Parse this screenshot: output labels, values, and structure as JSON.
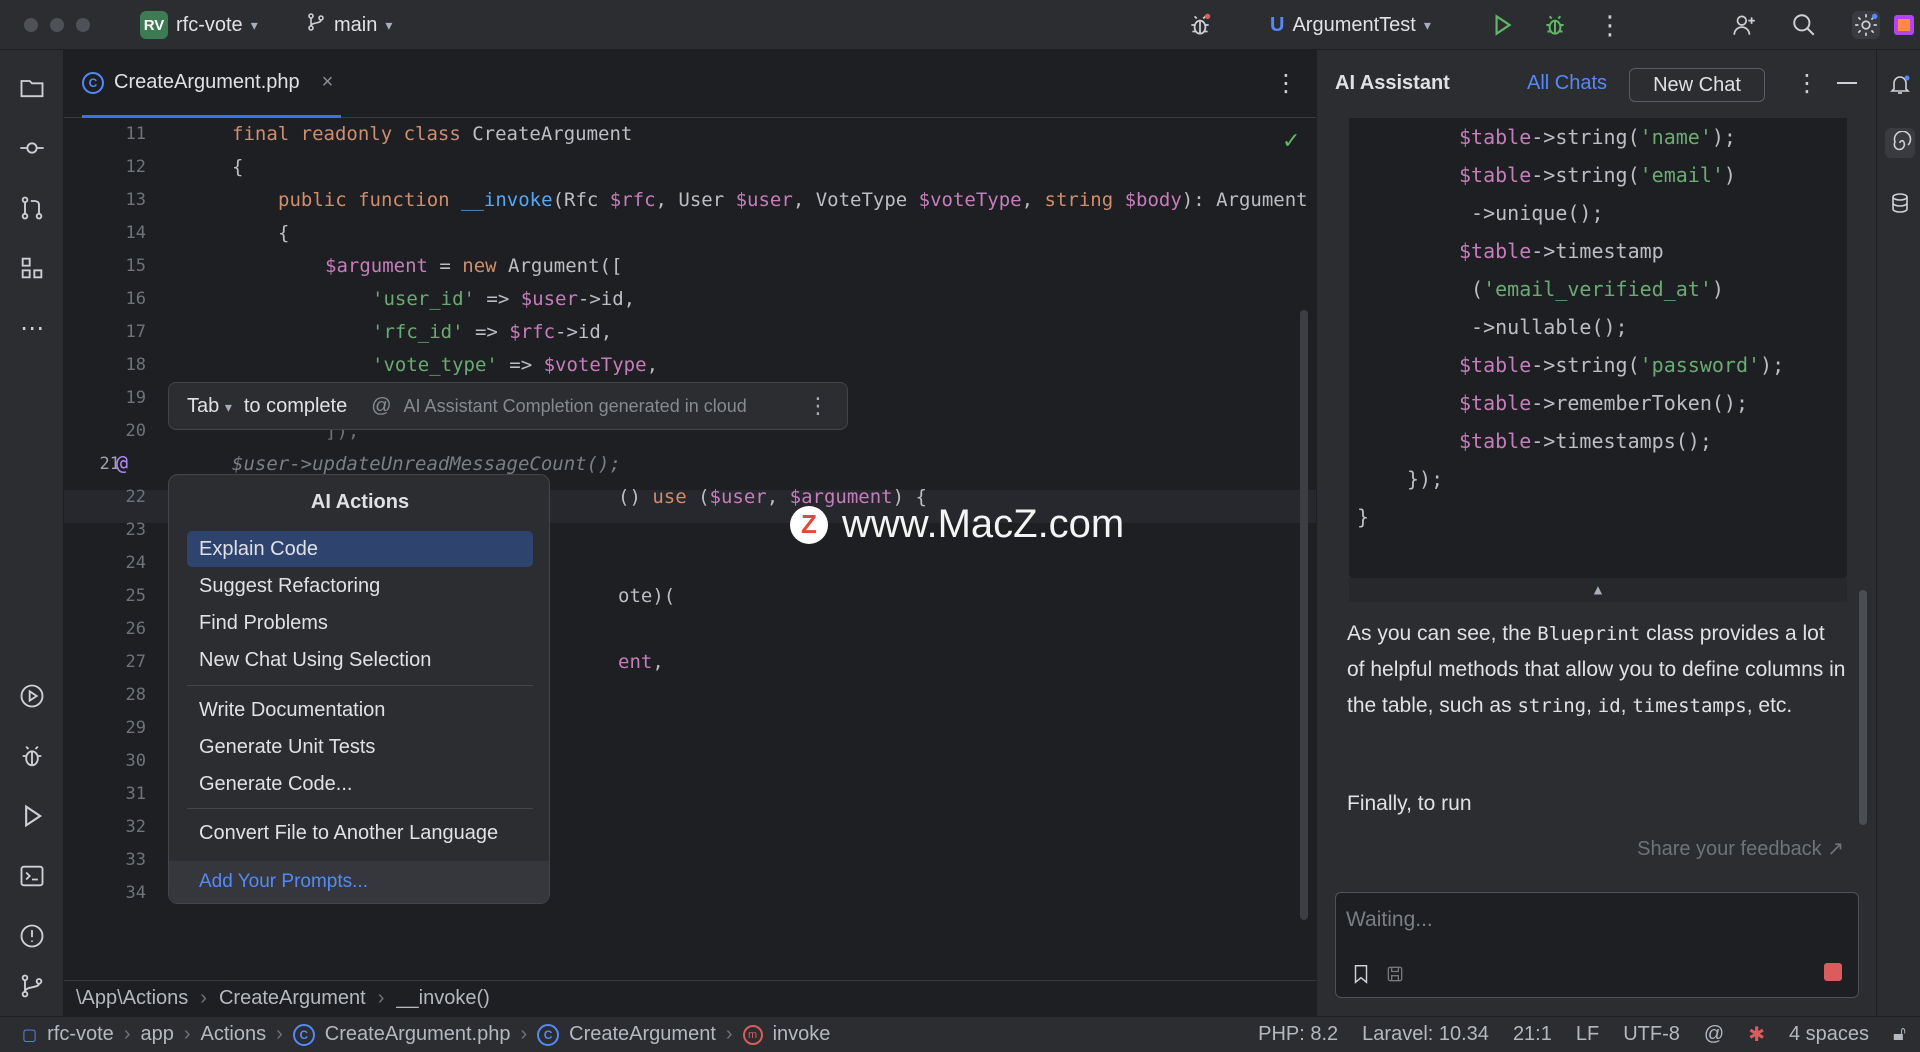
{
  "titlebar": {
    "project_badge": "RV",
    "project_name": "rfc-vote",
    "branch": "main",
    "run_config_badge": "U",
    "run_config": "ArgumentTest"
  },
  "editor": {
    "tab_label": "CreateArgument.php",
    "tab_icon_letter": "C",
    "line_numbers": [
      "11",
      "12",
      "13",
      "14",
      "15",
      "16",
      "17",
      "18",
      "19",
      "20",
      "21",
      "22",
      "23",
      "24",
      "25",
      "26",
      "27",
      "28",
      "29",
      "30",
      "31",
      "32",
      "33",
      "34"
    ],
    "code": {
      "l11_kw": "final readonly class",
      "l11_name": " CreateArgument",
      "l12": "{",
      "l13_kw": "public function",
      "l13_fn": "__invoke",
      "l13_p1": "(Rfc ",
      "l13_v1": "$rfc",
      "l13_p2": ", User ",
      "l13_v2": "$user",
      "l13_p3": ", VoteType ",
      "l13_v3": "$voteType",
      "l13_p4": ", ",
      "l13_kw2": "string",
      "l13_p5": " ",
      "l13_v4": "$body",
      "l13_p6": "): Argument",
      "l14": "{",
      "l15_v": "$argument",
      "l15_p1": " = ",
      "l15_kw": "new",
      "l15_p2": " Argument([",
      "l16_s": "'user_id'",
      "l16_p": " => ",
      "l16_v": "$user",
      "l16_e": "->id,",
      "l17_s": "'rfc_id'",
      "l17_p": " => ",
      "l17_v": "$rfc",
      "l17_e": "->id,",
      "l18_s": "'vote_type'",
      "l18_p": " => ",
      "l18_v": "$voteType",
      "l18_e": ",",
      "l20": "]);",
      "l21_ghost": "$user->updateUnreadMessageCount();",
      "l22_p": "() ",
      "l22_kw": "use",
      "l22_p2": " (",
      "l22_v1": "$user",
      "l22_p3": ", ",
      "l22_v2": "$argument",
      "l22_p4": ") {",
      "l25": "ote)(",
      "l27_var": "ent",
      "l27_end": ","
    },
    "breadcrumb": [
      "\\App\\Actions",
      "CreateArgument",
      "__invoke()"
    ]
  },
  "completion": {
    "key": "Tab",
    "action": "to complete",
    "note": "AI Assistant Completion generated in cloud"
  },
  "ai_actions": {
    "title": "AI Actions",
    "group1": [
      "Explain Code",
      "Suggest Refactoring",
      "Find Problems",
      "New Chat Using Selection"
    ],
    "group2": [
      "Write Documentation",
      "Generate Unit Tests",
      "Generate Code..."
    ],
    "group3": [
      "Convert File to Another Language"
    ],
    "footer": "Add Your Prompts..."
  },
  "watermark": {
    "logo_letter": "Z",
    "text": "www.MacZ.com"
  },
  "ai_panel": {
    "title": "AI Assistant",
    "all_chats": "All Chats",
    "new_chat": "New Chat",
    "code_lines": {
      "c1_v": "$table",
      "c1_m": "->string(",
      "c1_s": "'name'",
      "c1_e": ");",
      "c2_v": "$table",
      "c2_m": "->string(",
      "c2_s": "'email'",
      "c2_e": ")",
      "c3": " ->unique();",
      "c4_v": "$table",
      "c4_m": "->timestamp",
      "c5_p": " (",
      "c5_s": "'email_verified_at'",
      "c5_e": ")",
      "c6": " ->nullable();",
      "c7_v": "$table",
      "c7_m": "->string(",
      "c7_s": "'password'",
      "c7_e": ");",
      "c8_v": "$table",
      "c8_m": "->rememberToken();",
      "c9_v": "$table",
      "c9_m": "->timestamps();",
      "c10": "});",
      "c11": "}"
    },
    "para1_a": "As you can see, the ",
    "para1_code1": "Blueprint",
    "para1_b": " class provides a lot of helpful methods that allow you to define columns in the table, such as ",
    "para1_code2": "string",
    "para1_c": ", ",
    "para1_code3": "id",
    "para1_d": ", ",
    "para1_code4": "timestamps",
    "para1_e": ", etc.",
    "para2": "Finally, to run",
    "feedback": "Share your feedback ↗",
    "input_placeholder": "Waiting..."
  },
  "statusbar": {
    "left": [
      "rfc-vote",
      "app",
      "Actions",
      "CreateArgument.php",
      "CreateArgument",
      "invoke"
    ],
    "php": "PHP: 8.2",
    "laravel": "Laravel: 10.34",
    "position": "21:1",
    "line_sep": "LF",
    "encoding": "UTF-8",
    "indent": "4 spaces"
  },
  "colors": {
    "accent": "#3574f0",
    "link": "#548af7",
    "keyword": "#cf8e6d",
    "string": "#6aab73",
    "variable": "#c77dbb",
    "function": "#56a8f5"
  }
}
